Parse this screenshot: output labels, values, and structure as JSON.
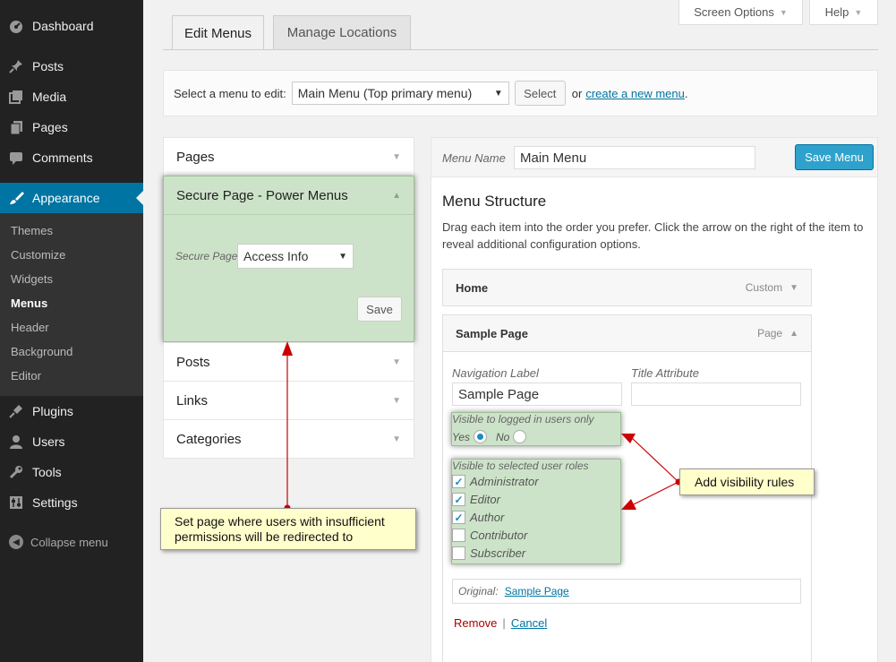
{
  "sidebar": {
    "items": [
      {
        "label": "Dashboard",
        "icon": "dashboard-icon"
      },
      {
        "label": "Posts",
        "icon": "pin-icon"
      },
      {
        "label": "Media",
        "icon": "media-icon"
      },
      {
        "label": "Pages",
        "icon": "pages-icon"
      },
      {
        "label": "Comments",
        "icon": "comment-icon"
      },
      {
        "label": "Appearance",
        "icon": "brush-icon"
      },
      {
        "label": "Plugins",
        "icon": "plug-icon"
      },
      {
        "label": "Users",
        "icon": "user-icon"
      },
      {
        "label": "Tools",
        "icon": "wrench-icon"
      },
      {
        "label": "Settings",
        "icon": "settings-icon"
      }
    ],
    "submenu": [
      "Themes",
      "Customize",
      "Widgets",
      "Menus",
      "Header",
      "Background",
      "Editor"
    ],
    "collapse_label": "Collapse menu"
  },
  "top": {
    "screen_options": "Screen Options",
    "help": "Help"
  },
  "tabs": [
    "Edit Menus",
    "Manage Locations"
  ],
  "select_bar": {
    "prompt": "Select a menu to edit:",
    "selected_menu": "Main Menu (Top primary menu)",
    "select_button": "Select",
    "or_text": "or",
    "create_link": "create a new menu",
    "period": "."
  },
  "left_panels": {
    "pages": "Pages",
    "secure": {
      "title": "Secure Page - Power Menus",
      "field_label": "Secure Page",
      "field_value": "Access Info",
      "save": "Save"
    },
    "posts": "Posts",
    "links": "Links",
    "categories": "Categories"
  },
  "menu": {
    "name_label": "Menu Name",
    "name_value": "Main Menu",
    "save_button": "Save Menu",
    "structure_title": "Menu Structure",
    "structure_desc": "Drag each item into the order you prefer. Click the arrow on the right of the item to reveal additional configuration options.",
    "items": [
      {
        "title": "Home",
        "type": "Custom"
      },
      {
        "title": "Sample Page",
        "type": "Page"
      }
    ],
    "nav_label_caption": "Navigation Label",
    "nav_label_value": "Sample Page",
    "title_attr_caption": "Title Attribute",
    "title_attr_value": "",
    "logged_in_caption": "Visible to logged in users only",
    "yes": "Yes",
    "no": "No",
    "logged_in_selected": "Yes",
    "roles_caption": "Visible to selected user roles",
    "roles": [
      {
        "name": "Administrator",
        "checked": true
      },
      {
        "name": "Editor",
        "checked": true
      },
      {
        "name": "Author",
        "checked": true
      },
      {
        "name": "Contributor",
        "checked": false
      },
      {
        "name": "Subscriber",
        "checked": false
      }
    ],
    "original_label": "Original:",
    "original_link": "Sample Page",
    "remove": "Remove",
    "separator": "|",
    "cancel": "Cancel"
  },
  "callouts": {
    "redirect": "Set page where users with insufficient permissions will be redirected to",
    "visibility": "Add visibility rules"
  },
  "colors": {
    "sidebar_bg": "#222222",
    "active_blue": "#0074a2",
    "highlight_green": "#cde3c9",
    "callout_yellow": "#ffffcc",
    "arrow_red": "#cc0000"
  }
}
